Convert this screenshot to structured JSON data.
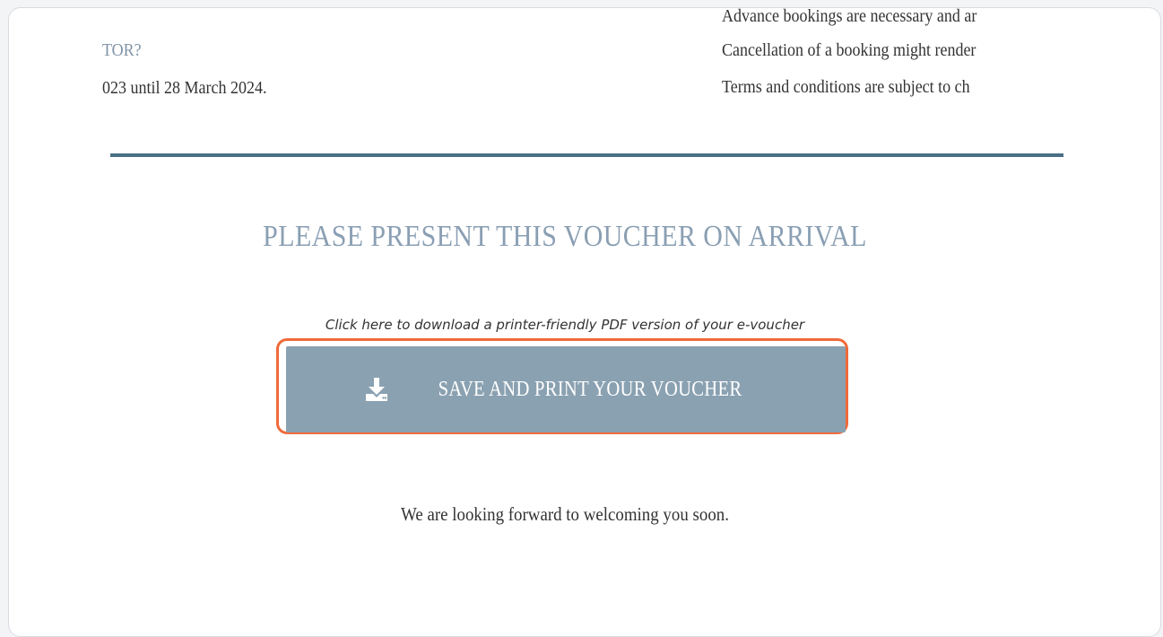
{
  "details": {
    "heading_fragment": "TOR?",
    "validity_fragment": "023 until 28 March 2024."
  },
  "terms": {
    "lines": [
      "Advance bookings are necessary and ar",
      "Cancellation of a booking might render",
      "Terms and conditions are subject to ch"
    ]
  },
  "voucher": {
    "heading": "PLEASE PRESENT THIS VOUCHER ON ARRIVAL",
    "download_hint": "Click here to download a printer-friendly PDF version of your e-voucher",
    "button_label": "SAVE AND PRINT YOUR VOUCHER",
    "button_icon": "download-icon",
    "welcome_text": "We are looking forward to welcoming you soon."
  },
  "colors": {
    "accent_divider": "#4a6f86",
    "heading_blue_gray": "#8a9fb3",
    "button_bg": "#8aa1b1",
    "highlight_ring": "#ef6a3a"
  }
}
